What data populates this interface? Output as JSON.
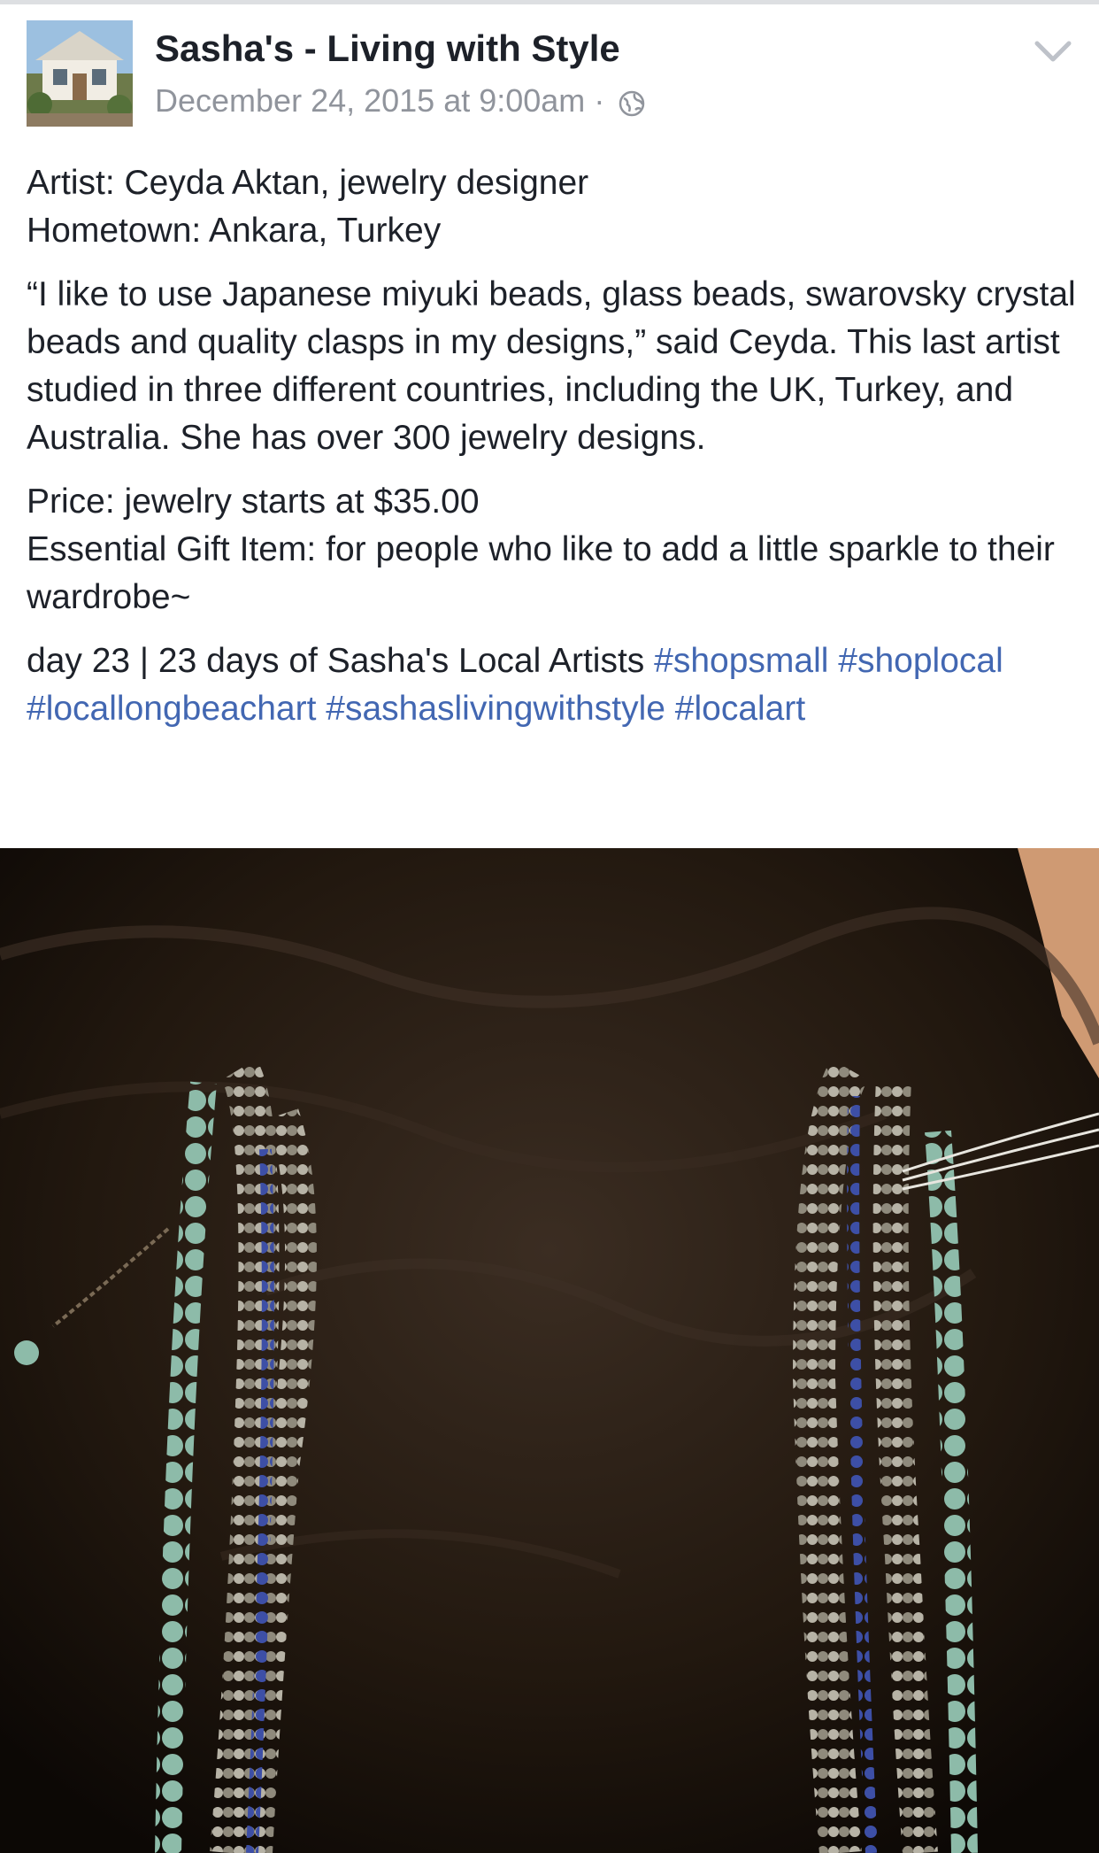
{
  "post": {
    "page_name": "Sasha's - Living with Style",
    "timestamp": "December 24, 2015 at 9:00am",
    "separator": "·",
    "privacy_icon": "globe-icon",
    "menu_icon": "chevron-down-icon"
  },
  "body": {
    "artist_line": "Artist: Ceyda Aktan, jewelry designer",
    "hometown_line": "Hometown: Ankara, Turkey",
    "quote_paragraph": "“I like to use Japanese miyuki beads, glass beads, swarovsky crystal beads and quality clasps in my designs,” said Ceyda. This last artist studied in three different countries, including the UK, Turkey, and Australia. She has over 300 jewelry designs.",
    "price_line": "Price: jewelry starts at $35.00",
    "gift_line": "Essential Gift Item: for people who like to add a little sparkle to their wardrobe~",
    "series_text": "day 23 | 23 days of Sasha's Local Artists ",
    "hashtags": [
      "#shopsmall",
      "#shoplocal",
      "#locallongbeachart",
      "#sashaslivingwithstyle",
      "#localart"
    ]
  },
  "colors": {
    "text": "#1d2129",
    "meta": "#90949c",
    "hashtag": "#4267b2",
    "divider": "#dddfe2"
  }
}
